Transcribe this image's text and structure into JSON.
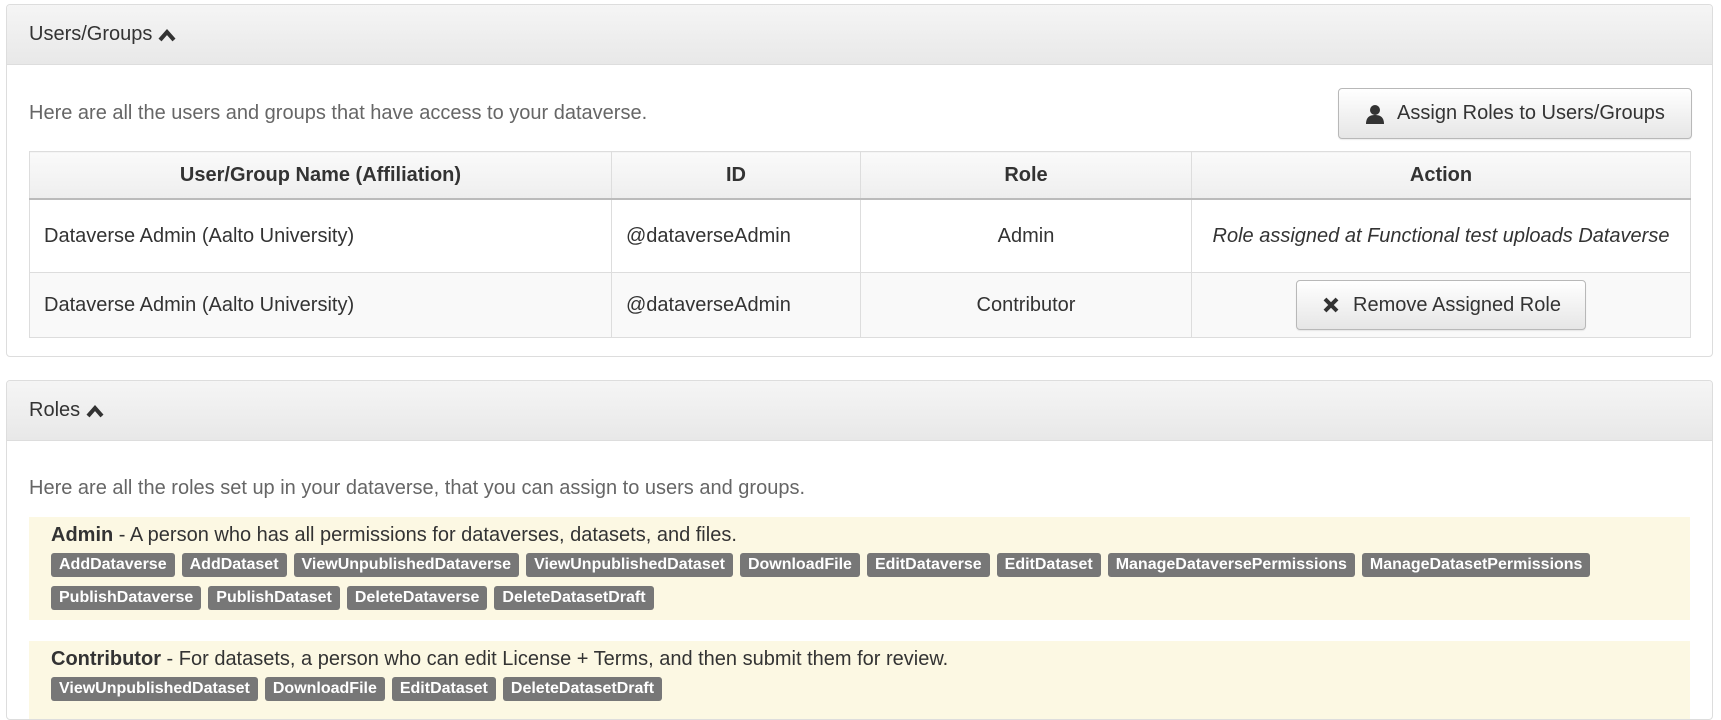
{
  "users_panel": {
    "heading": "Users/Groups",
    "intro": "Here are all the users and groups that have access to your dataverse.",
    "assign_button": "Assign Roles to Users/Groups",
    "columns": [
      "User/Group Name (Affiliation)",
      "ID",
      "Role",
      "Action"
    ],
    "rows": [
      {
        "name": "Dataverse Admin (Aalto University)",
        "id": "@dataverseAdmin",
        "role": "Admin",
        "action_note": "Role assigned at Functional test uploads Dataverse"
      },
      {
        "name": "Dataverse Admin (Aalto University)",
        "id": "@dataverseAdmin",
        "role": "Contributor",
        "action_button": "Remove Assigned Role"
      }
    ]
  },
  "roles_panel": {
    "heading": "Roles",
    "intro": "Here are all the roles set up in your dataverse, that you can assign to users and groups.",
    "roles": [
      {
        "name": "Admin",
        "description": " - A person who has all permissions for dataverses, datasets, and files.",
        "permissions": [
          "AddDataverse",
          "AddDataset",
          "ViewUnpublishedDataverse",
          "ViewUnpublishedDataset",
          "DownloadFile",
          "EditDataverse",
          "EditDataset",
          "ManageDataversePermissions",
          "ManageDatasetPermissions",
          "PublishDataverse",
          "PublishDataset",
          "DeleteDataverse",
          "DeleteDatasetDraft"
        ]
      },
      {
        "name": "Contributor",
        "description": " - For datasets, a person who can edit License + Terms, and then submit them for review.",
        "permissions": [
          "ViewUnpublishedDataset",
          "DownloadFile",
          "EditDataset",
          "DeleteDatasetDraft"
        ]
      }
    ]
  },
  "icons": {
    "collapse": "chevron-up-icon",
    "assign": "user-icon",
    "remove": "remove-x-icon"
  },
  "colors": {
    "label_bg": "#777777",
    "role_bg": "#fcf8e3",
    "heading_bg": "#f5f5f5"
  }
}
